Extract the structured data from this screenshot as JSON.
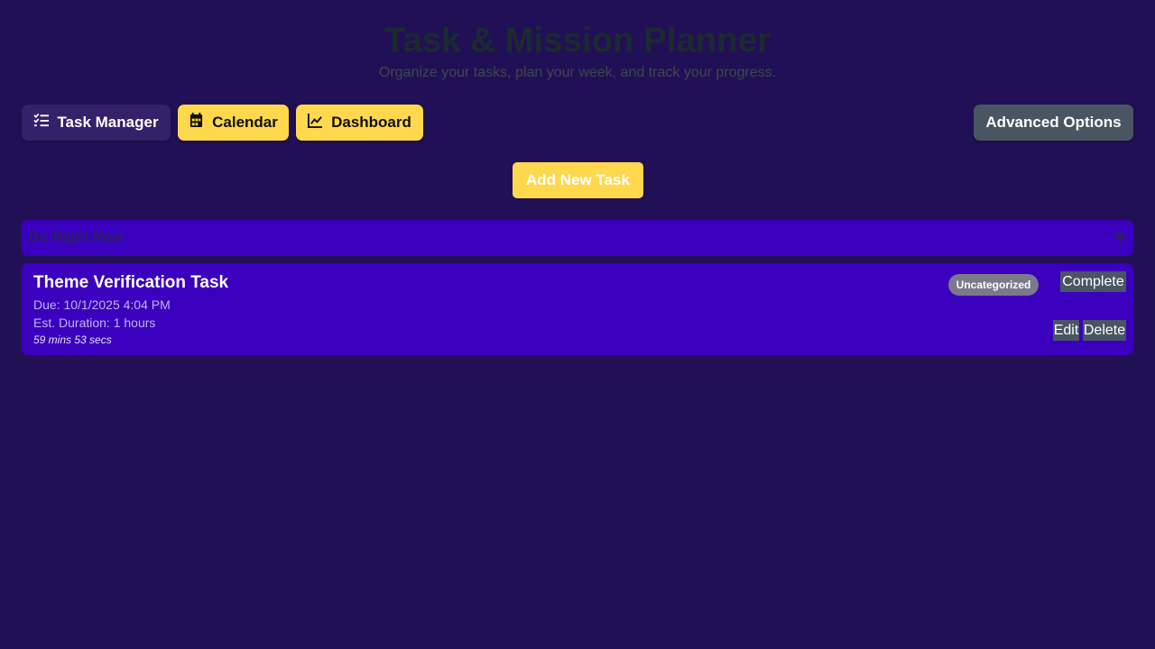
{
  "header": {
    "title": "Task & Mission Planner",
    "subtitle": "Organize your tasks, plan your week, and track your progress."
  },
  "nav": {
    "task_manager": "Task Manager",
    "calendar": "Calendar",
    "dashboard": "Dashboard",
    "advanced": "Advanced Options"
  },
  "add_task_label": "Add New Task",
  "section": {
    "title": "Do Right Now"
  },
  "task": {
    "title": "Theme Verification Task",
    "due": "Due: 10/1/2025 4:04 PM",
    "duration": "Est. Duration: 1 hours",
    "timer": "59 mins 53 secs",
    "category": "Uncategorized",
    "complete_label": "Complete",
    "edit_label": "Edit",
    "delete_label": "Delete"
  },
  "colors": {
    "background": "#221056",
    "accent": "#ffd84d",
    "section": "#3a00bd",
    "muted_button": "#4a5563"
  },
  "icons": {
    "task_manager": "list-check-icon",
    "calendar": "calendar-icon",
    "dashboard": "line-chart-icon",
    "section_toggle": "caret-down-icon"
  }
}
